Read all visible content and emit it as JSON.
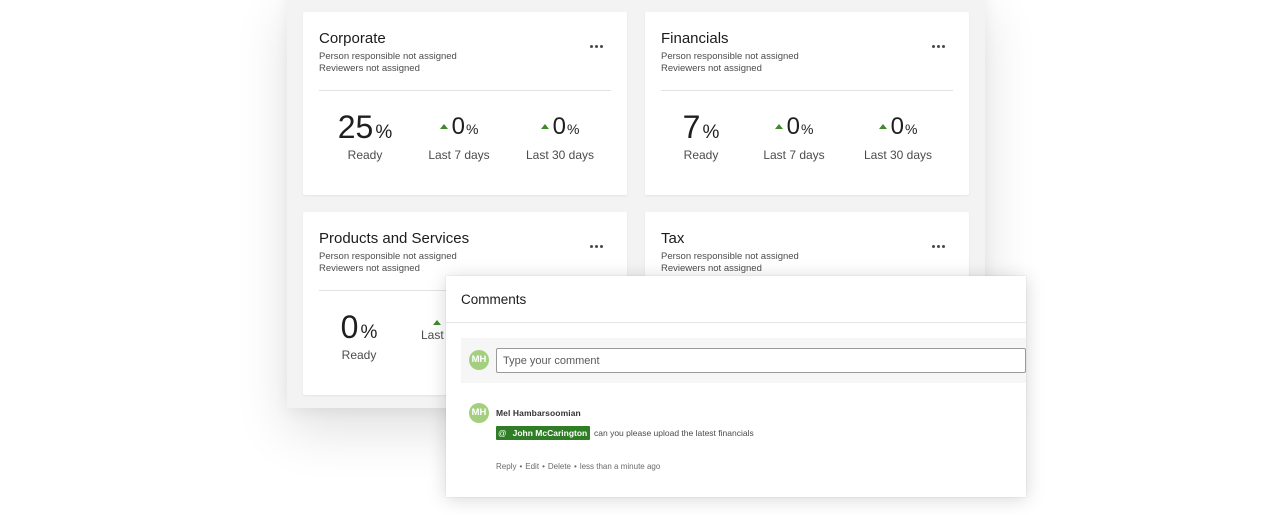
{
  "cards": [
    {
      "title": "Corporate",
      "person": "Person responsible not assigned",
      "reviewers": "Reviewers not assigned",
      "ready": {
        "value": "25",
        "unit": "%",
        "label": "Ready"
      },
      "last7": {
        "value": "0",
        "unit": "%",
        "label": "Last 7 days",
        "trend": "up"
      },
      "last30": {
        "value": "0",
        "unit": "%",
        "label": "Last 30 days",
        "trend": "up"
      }
    },
    {
      "title": "Financials",
      "person": "Person responsible not assigned",
      "reviewers": "Reviewers not assigned",
      "ready": {
        "value": "7",
        "unit": "%",
        "label": "Ready"
      },
      "last7": {
        "value": "0",
        "unit": "%",
        "label": "Last 7 days",
        "trend": "up"
      },
      "last30": {
        "value": "0",
        "unit": "%",
        "label": "Last 30 days",
        "trend": "up"
      }
    },
    {
      "title": "Products and Services",
      "person": "Person responsible not assigned",
      "reviewers": "Reviewers not assigned",
      "ready": {
        "value": "0",
        "unit": "%",
        "label": "Ready"
      },
      "last7": {
        "value": "",
        "unit": "",
        "label": "Last",
        "trend": "up"
      }
    },
    {
      "title": "Tax",
      "person": "Person responsible not assigned",
      "reviewers": "Reviewers not assigned"
    }
  ],
  "comments": {
    "title": "Comments",
    "input_placeholder": "Type your comment",
    "current_user_initials": "MH",
    "items": [
      {
        "initials": "MH",
        "author": "Mel Hambarsoomian",
        "mention_symbol": "@",
        "mention": "John McCarington",
        "text": "can you please upload the latest financials",
        "reply": "Reply",
        "edit": "Edit",
        "delete": "Delete",
        "separator": "•",
        "time": "less than a minute ago"
      }
    ]
  },
  "colors": {
    "trend_up": "#3f8a2a",
    "avatar": "#a3cf7f",
    "mention_bg": "#2f7d24"
  },
  "icons": {
    "more": "ellipsis-icon",
    "trend": "triangle-up-icon"
  }
}
